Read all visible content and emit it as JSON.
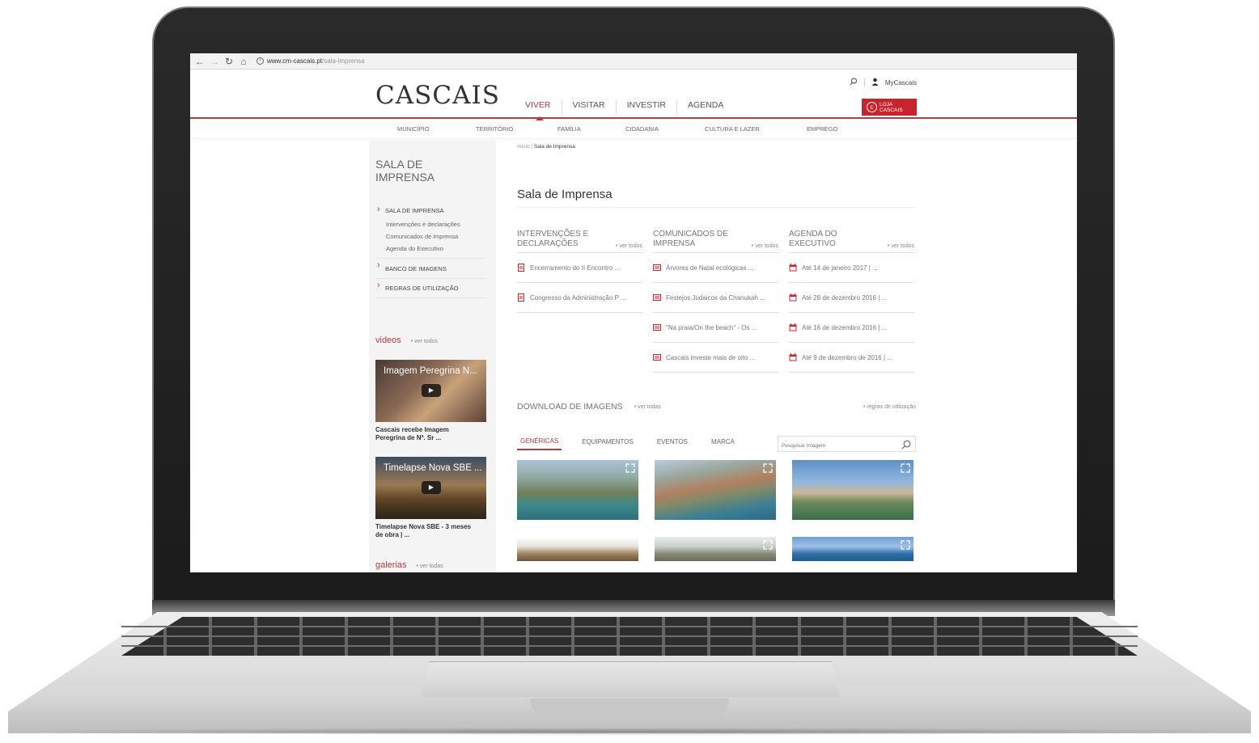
{
  "browser": {
    "url_host": "www.cm-cascais.pt",
    "url_path": "/sala-imprensa"
  },
  "header": {
    "logo": "CASCAIS",
    "nav": [
      "VIVER",
      "VISITAR",
      "INVESTIR",
      "AGENDA"
    ],
    "mycascais": "MyCascais",
    "loja_line1": "LOJA",
    "loja_line2": "CASCAIS",
    "subnav": [
      "MUNICÍPIO",
      "TERRITÓRIO",
      "FAMÍLIA",
      "CIDADANIA",
      "CULTURA E LAZER",
      "EMPREGO"
    ]
  },
  "sidebar": {
    "title_line1": "SALA DE",
    "title_line2": "IMPRENSA",
    "menu": {
      "head1": "SALA DE IMPRENSA",
      "sub1": "Intervenções e declarações",
      "sub2": "Comunicados de imprensa",
      "sub3": "Agenda do Executivo",
      "head2": "BANCO DE IMAGENS",
      "head3": "REGRAS DE UTILIZAÇÃO"
    },
    "videos_label": "videos",
    "videos_more": "• ver todos",
    "video1_title": "Imagem Peregrina N...",
    "video1_caption_l1": "Cascais recebe Imagem",
    "video1_caption_l2": "Peregrina de Nª. Sr ...",
    "video2_title": "Timelapse Nova SBE ...",
    "video2_caption_l1": "Timelapse Nova SBE - 3 meses",
    "video2_caption_l2": "de obra | ...",
    "galerias_label": "galerias",
    "galerias_more": "• ver todas"
  },
  "main": {
    "crumb_home": "Início",
    "crumb_current": "Sala de Imprensa",
    "title": "Sala de Imprensa",
    "col1": {
      "title_l1": "INTERVENÇÕES E",
      "title_l2": "DECLARAÇÕES",
      "more": "• ver todos",
      "items": [
        "Encerramento do II Encontro ...",
        "Congresso da Administração P ..."
      ]
    },
    "col2": {
      "title_l1": "COMUNICADOS DE",
      "title_l2": "IMPRENSA",
      "more": "• ver todos",
      "items": [
        "Árvores de Natal ecológicas ...",
        "Festejos Judaicos da Chanukah ...",
        "\"Na praia/On the beach\" - Os ...",
        "Cascais investe mais de oito ..."
      ]
    },
    "col3": {
      "title_l1": "AGENDA DO",
      "title_l2": "EXECUTIVO",
      "more": "• ver todos",
      "items": [
        "Até 14 de janeiro 2017 | ...",
        "Até 28 de dezembro 2016 | ...",
        "Até 16 de dezembro 2016 | ...",
        "Até 9 de dezembro de 2016 | ..."
      ]
    },
    "download_title": "DOWNLOAD DE IMAGENS",
    "download_more": "• ver todas",
    "download_rules": "• regras de utilização",
    "tabs": [
      "GENÉRICAS",
      "EQUIPAMENTOS",
      "EVENTOS",
      "MARCA"
    ],
    "search_placeholder": "Pesquisar Imagem"
  },
  "colors": {
    "accent": "#b73a3f",
    "loja": "#c8242d",
    "sidebar_bg": "#f4f4f4"
  }
}
